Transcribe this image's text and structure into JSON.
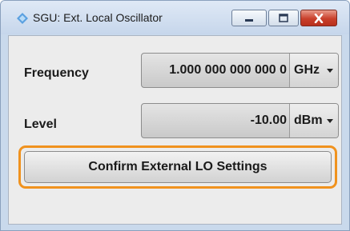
{
  "window": {
    "title": "SGU: Ext. Local Oscillator",
    "icon": "rs-app-icon",
    "controls": [
      "minimize",
      "maximize",
      "close"
    ],
    "close_color": "#c9402b"
  },
  "frequency": {
    "label": "Frequency",
    "value": "1.000 000 000 000 0",
    "unit": "GHz"
  },
  "level": {
    "label": "Level",
    "value": "-10.00",
    "unit": "dBm"
  },
  "confirm": {
    "label": "Confirm External LO Settings",
    "highlight_color": "#f0921e"
  }
}
